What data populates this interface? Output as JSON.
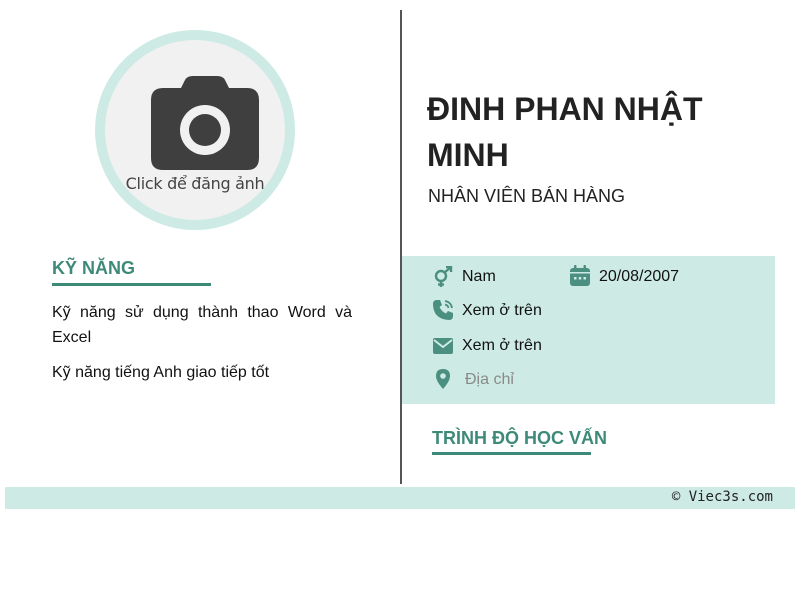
{
  "photo": {
    "label": "Click để đăng ảnh",
    "icon": "camera-icon"
  },
  "skills": {
    "title": "KỸ NĂNG",
    "items": [
      "Kỹ năng sử dụng thành thao Word và Excel",
      "Kỹ năng tiếng Anh giao tiếp tốt"
    ]
  },
  "profile": {
    "name": "ĐINH PHAN NHẬT MINH",
    "job_title": "NHÂN VIÊN BÁN HÀNG"
  },
  "contact": {
    "gender": "Nam",
    "birthdate": "20/08/2007",
    "phone": "Xem ở trên",
    "email": "Xem ở trên",
    "address_placeholder": "Địa chỉ"
  },
  "education": {
    "title": "TRÌNH ĐỘ HỌC VẤN"
  },
  "footer": {
    "text": "© Viec3s.com"
  },
  "colors": {
    "accent": "#3e8a78",
    "accent_light": "#cdebe4",
    "icon": "#4a8f7f"
  }
}
